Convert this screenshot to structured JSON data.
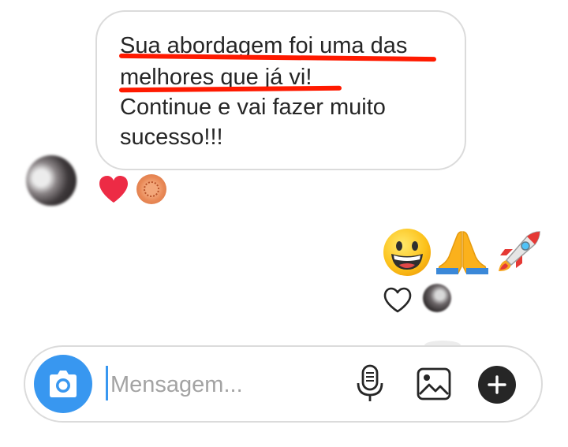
{
  "message": {
    "lines": [
      "Sua abordagem foi uma das",
      "melhores  que já vi!",
      "Continue e vai fazer muito",
      "sucesso!!!"
    ]
  },
  "reactions": [
    "heart-icon",
    "peach-bubble-sticker"
  ],
  "sent_emojis": [
    "grinning-face-emoji",
    "folded-hands-emoji",
    "rocket-emoji"
  ],
  "composer": {
    "placeholder": "Mensagem..."
  },
  "colors": {
    "accent": "#3897f0",
    "underline": "#ff1a00",
    "heart": "#ed2b45",
    "border": "#dbdbdb",
    "text": "#262626",
    "placeholder": "#a3a3a3"
  }
}
